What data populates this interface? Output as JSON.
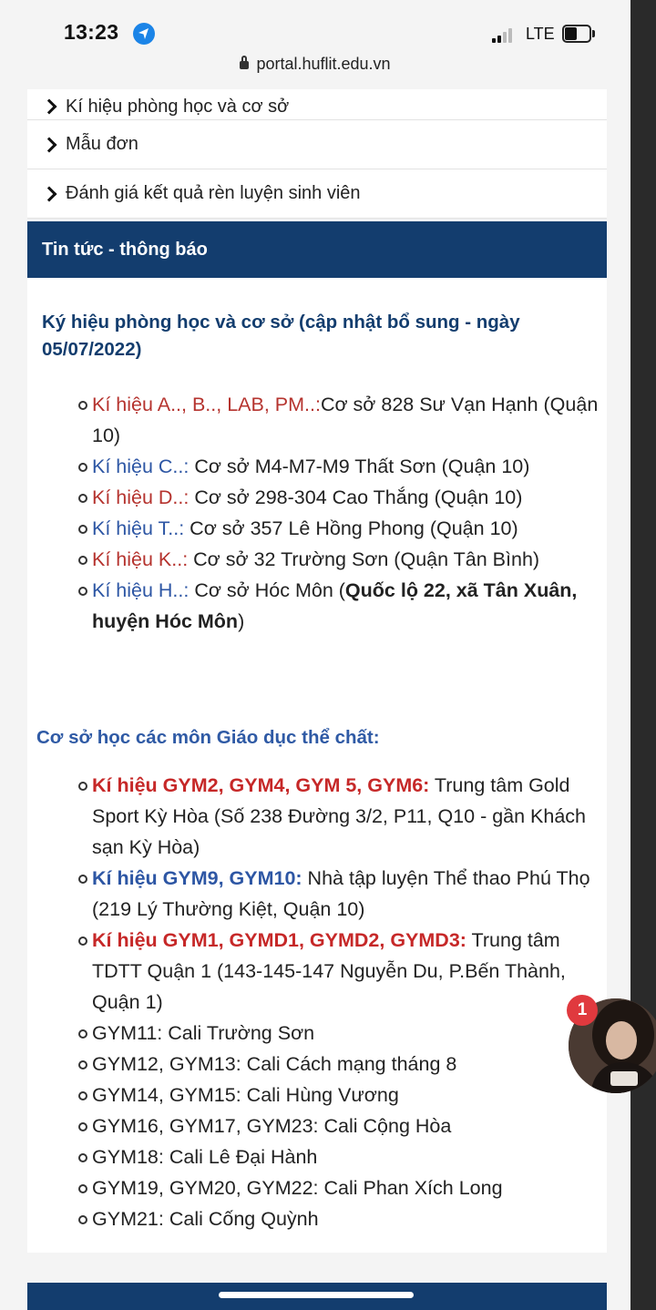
{
  "status_bar": {
    "time": "13:23",
    "network": "LTE",
    "location_icon": "location-arrow-icon",
    "battery_icon": "battery-icon"
  },
  "browser": {
    "url": "portal.huflit.edu.vn"
  },
  "menu": {
    "items": [
      {
        "label": "Kí hiệu phòng học và cơ sở"
      },
      {
        "label": "Mẫu đơn"
      },
      {
        "label": "Đánh giá kết quả rèn luyện sinh viên"
      }
    ]
  },
  "news": {
    "header": "Tin tức - thông báo",
    "title1": "Ký hiệu phòng học và cơ sở (cập nhật bổ sung - ngày 05/07/2022)",
    "list1": [
      {
        "label": "Kí hiệu A.., B.., LAB, PM..:",
        "text": "Cơ sở 828 Sư Vạn Hạnh (Quận 10)"
      },
      {
        "label": "Kí hiệu C..:",
        "text": " Cơ sở M4-M7-M9 Thất Sơn (Quận 10)"
      },
      {
        "label": "Kí hiệu D..:",
        "text": " Cơ sở 298-304 Cao Thắng (Quận 10)"
      },
      {
        "label": "Kí hiệu T..:",
        "text": " Cơ sở 357 Lê Hồng Phong (Quận 10)"
      },
      {
        "label": "Kí hiệu K..:",
        "text": " Cơ sở 32 Trường Sơn (Quận Tân Bình)"
      },
      {
        "label": "Kí hiệu H..:",
        "text": " Cơ sở Hóc Môn (",
        "bold": "Quốc lộ 22, xã Tân Xuân, huyện Hóc Môn",
        "tail": ")"
      }
    ],
    "title2": "Cơ sở học các môn Giáo dục thể chất:",
    "list2": [
      {
        "label": "Kí hiệu GYM2, GYM4, GYM 5, GYM6:",
        "text": " Trung tâm Gold Sport Kỳ Hòa (Số 238 Đường 3/2, P11, Q10 - gần Khách sạn Kỳ Hòa)"
      },
      {
        "label": "Kí hiệu GYM9, GYM10:",
        "text": " Nhà tập luyện Thể thao Phú Thọ (219 Lý Thường Kiệt, Quận 10)"
      },
      {
        "label": "Kí hiệu GYM1, GYMD1, GYMD2, GYMD3:",
        "text": " Trung tâm TDTT Quận 1 (143-145-147 Nguyễn Du, P.Bến Thành, Quận 1)"
      },
      {
        "text": "GYM11:  Cali Trường Sơn"
      },
      {
        "text": "GYM12, GYM13:  Cali Cách mạng tháng 8"
      },
      {
        "text": "GYM14, GYM15:  Cali Hùng Vương"
      },
      {
        "text": "GYM16, GYM17, GYM23:  Cali Cộng Hòa"
      },
      {
        "text": "GYM18:  Cali Lê Đại Hành"
      },
      {
        "text": "GYM19, GYM20, GYM22:  Cali Phan Xích Long"
      },
      {
        "text": "GYM21: Cali Cống Quỳnh"
      }
    ]
  },
  "chat_head": {
    "badge_count": "1"
  }
}
